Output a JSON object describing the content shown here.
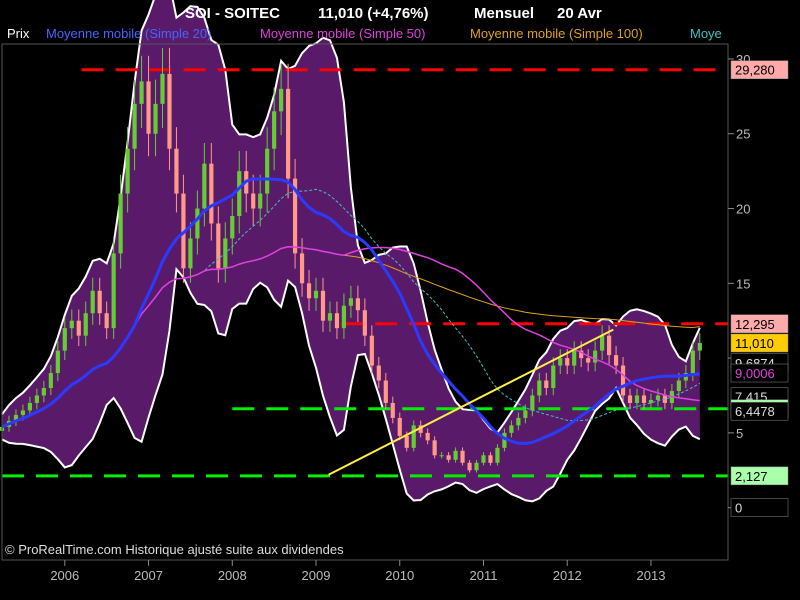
{
  "header": {
    "title": "SOI - SOITEC",
    "price": "11,010 (+4,76%)",
    "period": "Mensuel",
    "date": "20 Avr"
  },
  "legend": [
    {
      "label": "Prix",
      "color": "#ffffff"
    },
    {
      "label": "Moyenne mobile (Simple 20)",
      "color": "#4444ff"
    },
    {
      "label": "Moyenne mobile (Simple 50)",
      "color": "#e040e0"
    },
    {
      "label": "Moyenne mobile (Simple 100)",
      "color": "#e0a020"
    },
    {
      "label": "Moye",
      "color": "#40c0c0"
    }
  ],
  "footer": {
    "copyright": "© ProRealTime.com Historique ajusté suite aux dividendes"
  },
  "price_tags": [
    {
      "label": "29,280",
      "value": 29.28,
      "bg": "#ffaaaa",
      "fg": "#000000"
    },
    {
      "label": "12,295",
      "value": 12.295,
      "bg": "#ffaaaa",
      "fg": "#000000"
    },
    {
      "label": "11,010",
      "value": 11.01,
      "bg": "#ffcc00",
      "fg": "#000000"
    },
    {
      "label": "9,6874",
      "value": 9.6874,
      "bg": "#000000",
      "fg": "#dddddd"
    },
    {
      "label": "9,0006",
      "value": 9.0006,
      "bg": "#000000",
      "fg": "#e040e0"
    },
    {
      "label": "7,415",
      "value": 7.415,
      "bg": "#000000",
      "fg": "#dddddd"
    },
    {
      "label": "6,610",
      "value": 6.61,
      "bg": "#aaffaa",
      "fg": "#000000"
    },
    {
      "label": "6,4478",
      "value": 6.4478,
      "bg": "#000000",
      "fg": "#dddddd"
    },
    {
      "label": "2,127",
      "value": 2.127,
      "bg": "#aaffaa",
      "fg": "#000000"
    },
    {
      "label": "0",
      "value": 0,
      "bg": "#000000",
      "fg": "#dddddd"
    }
  ],
  "colors": {
    "background": "#000000",
    "band_fill": "#5a1a6a",
    "band_edge": "#ffffff",
    "up_candle": "#66cc33",
    "down_candle": "#ff9988",
    "ma20": "#2a3aff",
    "ma50": "#e040e0",
    "ma100": "#e0a020",
    "ma_extra": "#40c0c0",
    "resistance": "#ff0000",
    "support": "#00ee00",
    "trendline": "#ffee44",
    "axis_text": "#bbbbbb"
  },
  "chart_data": {
    "type": "candlestick",
    "title": "SOI - SOITEC",
    "x_range": [
      "2005.25",
      "2013.92"
    ],
    "x_ticks": [
      "2006",
      "2007",
      "2008",
      "2009",
      "2010",
      "2011",
      "2012",
      "2013"
    ],
    "ylim": [
      -3.5,
      31
    ],
    "y_ticks": [
      0,
      5,
      10,
      15,
      20,
      25,
      30
    ],
    "grid": false,
    "closes": [
      5.4,
      5.8,
      6.2,
      6.5,
      7.0,
      7.5,
      8.0,
      9.0,
      10.5,
      12.0,
      12.5,
      11.5,
      13.0,
      14.5,
      13.0,
      12.0,
      17.0,
      21.0,
      24.0,
      27.0,
      28.5,
      25.0,
      27.0,
      29.0,
      24.0,
      21.0,
      16.0,
      18.0,
      20.0,
      23.0,
      19.0,
      16.0,
      18.0,
      19.5,
      22.5,
      21.0,
      20.0,
      21.0,
      24.0,
      26.5,
      28.0,
      22.0,
      17.0,
      15.0,
      14.0,
      14.5,
      12.5,
      13.0,
      12.0,
      13.5,
      14.0,
      13.2,
      11.5,
      9.5,
      8.5,
      7.0,
      6.0,
      4.8,
      4.0,
      5.5,
      5.0,
      4.5,
      3.5,
      3.5,
      3.2,
      3.8,
      3.0,
      2.5,
      3.0,
      3.5,
      3.0,
      4.0,
      5.0,
      5.5,
      6.0,
      6.5,
      7.5,
      8.5,
      8.0,
      9.5,
      10.0,
      9.5,
      10.5,
      10.0,
      9.7,
      10.5,
      11.5,
      10.2,
      9.5,
      7.5,
      7.0,
      7.5,
      7.0,
      7.2,
      7.5,
      7.0,
      7.8,
      8.5,
      9.0,
      10.5,
      11.01
    ],
    "resistance_levels": [
      29.28,
      12.295
    ],
    "support_levels": [
      6.61,
      2.127
    ],
    "trendline": {
      "from": [
        "2009.15",
        2.2
      ],
      "to": [
        "2012.55",
        11.9
      ]
    }
  }
}
